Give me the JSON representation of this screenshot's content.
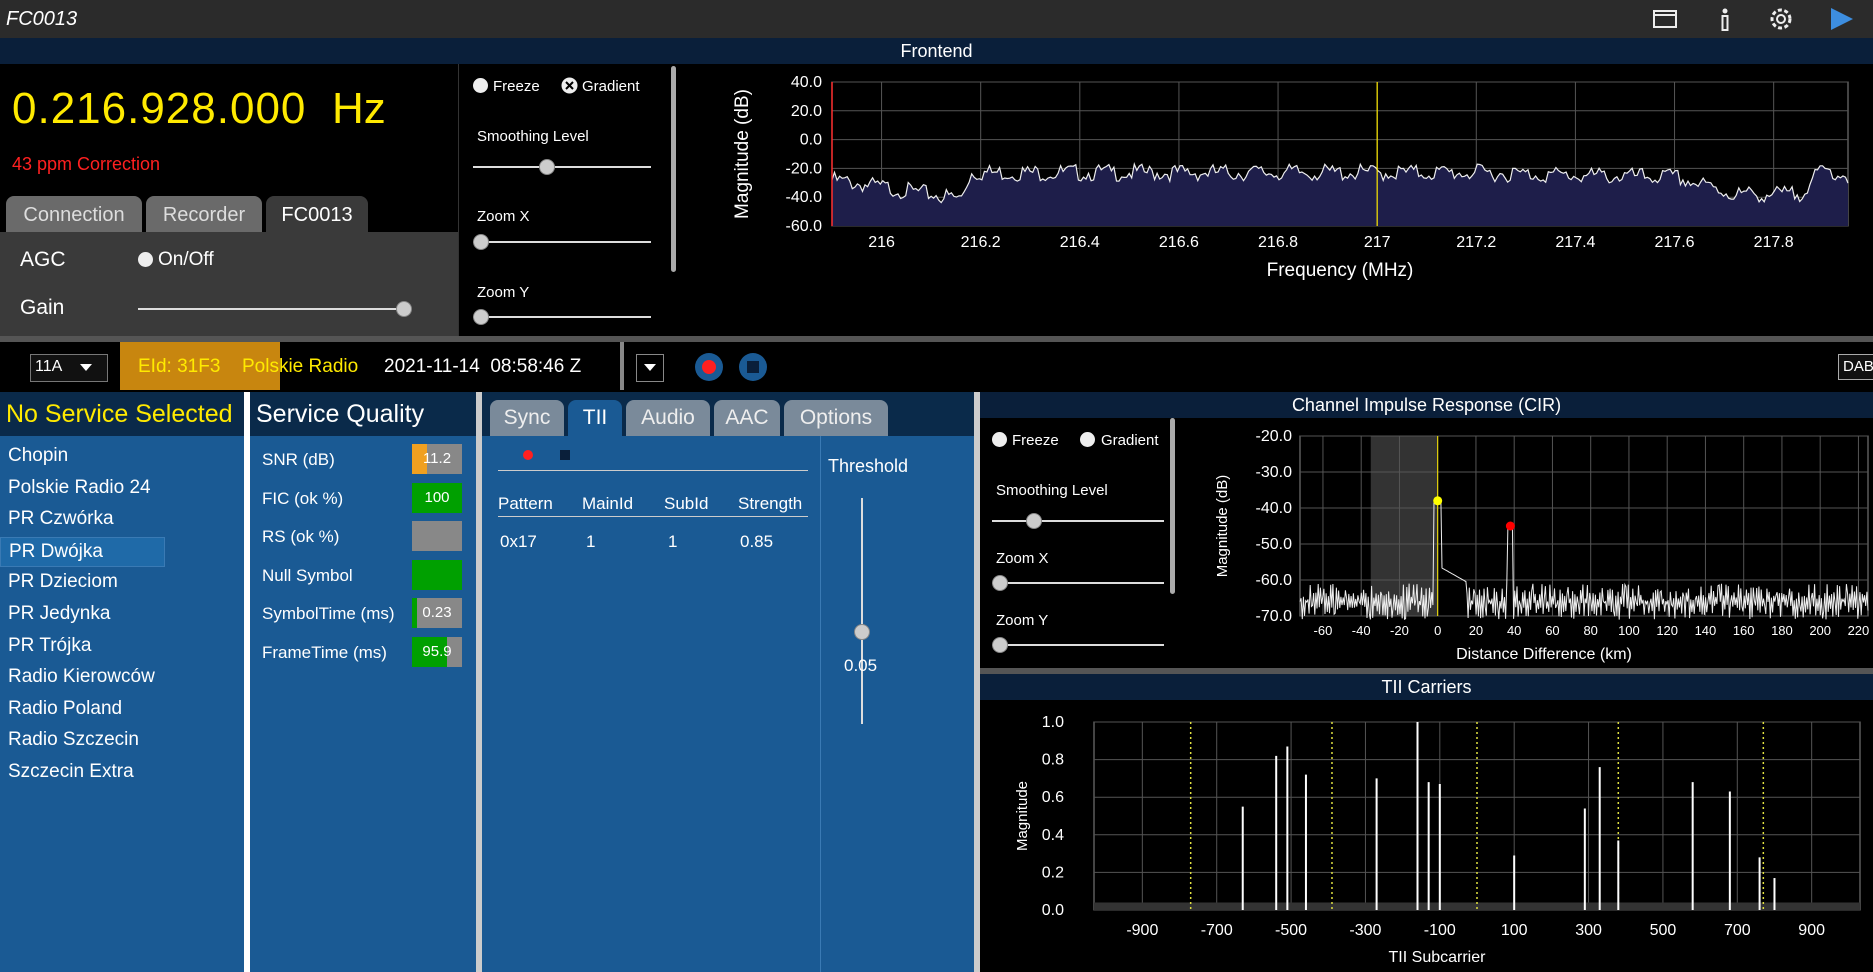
{
  "window": {
    "title": "FC0013"
  },
  "frontend": {
    "header": "Frontend",
    "frequency": "0.216.928.000",
    "frequency_unit": "Hz",
    "correction": "43 ppm Correction",
    "tabs": [
      "Connection",
      "Recorder",
      "FC0013"
    ],
    "agc_label": "AGC",
    "agc_toggle": "On/Off",
    "gain_label": "Gain",
    "freeze": "Freeze",
    "gradient": "Gradient",
    "smoothing": "Smoothing Level",
    "zoom_x": "Zoom X",
    "zoom_y": "Zoom Y"
  },
  "spectrum": {
    "ylabel": "Magnitude (dB)",
    "xlabel": "Frequency (MHz)",
    "y_ticks": [
      "40.0",
      "20.0",
      "0.0",
      "-20.0",
      "-40.0",
      "-60.0"
    ],
    "x_ticks": [
      "216",
      "216.2",
      "216.4",
      "216.6",
      "216.8",
      "217",
      "217.2",
      "217.4",
      "217.6",
      "217.8"
    ]
  },
  "statusbar": {
    "channel": "11A",
    "eid": "EId: 31F3",
    "ensemble": "Polskie Radio",
    "datetime": "2021-11-14  08:58:46 Z",
    "mode": "DAB"
  },
  "services": {
    "header": "No Service Selected",
    "items": [
      "Chopin",
      "Polskie Radio 24",
      "PR Czwórka",
      "PR Dwójka",
      "PR Dzieciom",
      "PR Jedynka",
      "PR Trójka",
      "Radio Kierowców",
      "Radio Poland",
      "Radio Szczecin",
      "Szczecin Extra"
    ],
    "selected": "PR Dwójka"
  },
  "quality": {
    "header": "Service Quality",
    "rows": [
      {
        "label": "SNR (dB)",
        "value": "11.2"
      },
      {
        "label": "FIC (ok %)",
        "value": "100"
      },
      {
        "label": "RS (ok %)",
        "value": ""
      },
      {
        "label": "Null Symbol",
        "value": ""
      },
      {
        "label": "SymbolTime (ms)",
        "value": "0.23"
      },
      {
        "label": "FrameTime (ms)",
        "value": "95.9"
      }
    ]
  },
  "tii": {
    "tabs": [
      "Sync",
      "TII",
      "Audio",
      "AAC",
      "Options"
    ],
    "columns": [
      "Pattern",
      "MainId",
      "SubId",
      "Strength"
    ],
    "row": {
      "pattern": "0x17",
      "mainid": "1",
      "subid": "1",
      "strength": "0.85"
    },
    "threshold_label": "Threshold",
    "threshold_value": "0.05"
  },
  "cir": {
    "header": "Channel Impulse Response (CIR)",
    "freeze": "Freeze",
    "gradient": "Gradient",
    "smoothing": "Smoothing Level",
    "zoom_x": "Zoom X",
    "zoom_y": "Zoom Y",
    "ylabel": "Magnitude (dB)",
    "xlabel": "Distance Difference (km)",
    "y_ticks": [
      "-20.0",
      "-30.0",
      "-40.0",
      "-50.0",
      "-60.0",
      "-70.0"
    ],
    "x_ticks": [
      "-60",
      "-40",
      "-20",
      "0",
      "20",
      "40",
      "60",
      "80",
      "100",
      "120",
      "140",
      "160",
      "180",
      "200",
      "220"
    ]
  },
  "carriers": {
    "header": "TII Carriers",
    "ylabel": "Magnitude",
    "xlabel": "TII Subcarrier",
    "y_ticks": [
      "1.0",
      "0.8",
      "0.6",
      "0.4",
      "0.2",
      "0.0"
    ],
    "x_ticks": [
      "-900",
      "-700",
      "-500",
      "-300",
      "-100",
      "100",
      "300",
      "500",
      "700",
      "900"
    ]
  },
  "chart_data": [
    {
      "type": "line",
      "title": "Frontend",
      "xlabel": "Frequency (MHz)",
      "ylabel": "Magnitude (dB)",
      "xlim": [
        215.9,
        217.95
      ],
      "ylim": [
        -60,
        40
      ],
      "x_marker": 217.0,
      "x": [
        215.9,
        216.0,
        216.1,
        216.16,
        216.18,
        216.4,
        216.6,
        216.8,
        217.0,
        217.2,
        217.4,
        217.6,
        217.72,
        217.85,
        217.9,
        217.95
      ],
      "y": [
        -25,
        -30,
        -35,
        -38,
        -20,
        -20,
        -20,
        -20,
        -20,
        -20,
        -22,
        -23,
        -35,
        -35,
        -18,
        -22
      ]
    },
    {
      "type": "line",
      "title": "Channel Impulse Response (CIR)",
      "xlabel": "Distance Difference (km)",
      "ylabel": "Magnitude (dB)",
      "xlim": [
        -72,
        225
      ],
      "ylim": [
        -70,
        -20
      ],
      "peaks": [
        {
          "x": 0,
          "y": -38,
          "color": "#ffff00"
        },
        {
          "x": 38,
          "y": -45,
          "color": "#ff0000"
        }
      ]
    },
    {
      "type": "bar",
      "title": "TII Carriers",
      "xlabel": "TII Subcarrier",
      "ylabel": "Magnitude",
      "xlim": [
        -1030,
        1030
      ],
      "ylim": [
        0,
        1.0
      ],
      "x": [
        -630,
        -540,
        -510,
        -460,
        -270,
        -160,
        -130,
        -100,
        100,
        290,
        330,
        380,
        580,
        680,
        760,
        800
      ],
      "values": [
        0.55,
        0.82,
        0.87,
        0.72,
        0.7,
        1.0,
        0.68,
        0.67,
        0.29,
        0.54,
        0.76,
        0.37,
        0.68,
        0.63,
        0.28,
        0.17
      ],
      "dotted_lines": [
        -770,
        -390,
        0,
        380,
        770
      ]
    }
  ]
}
